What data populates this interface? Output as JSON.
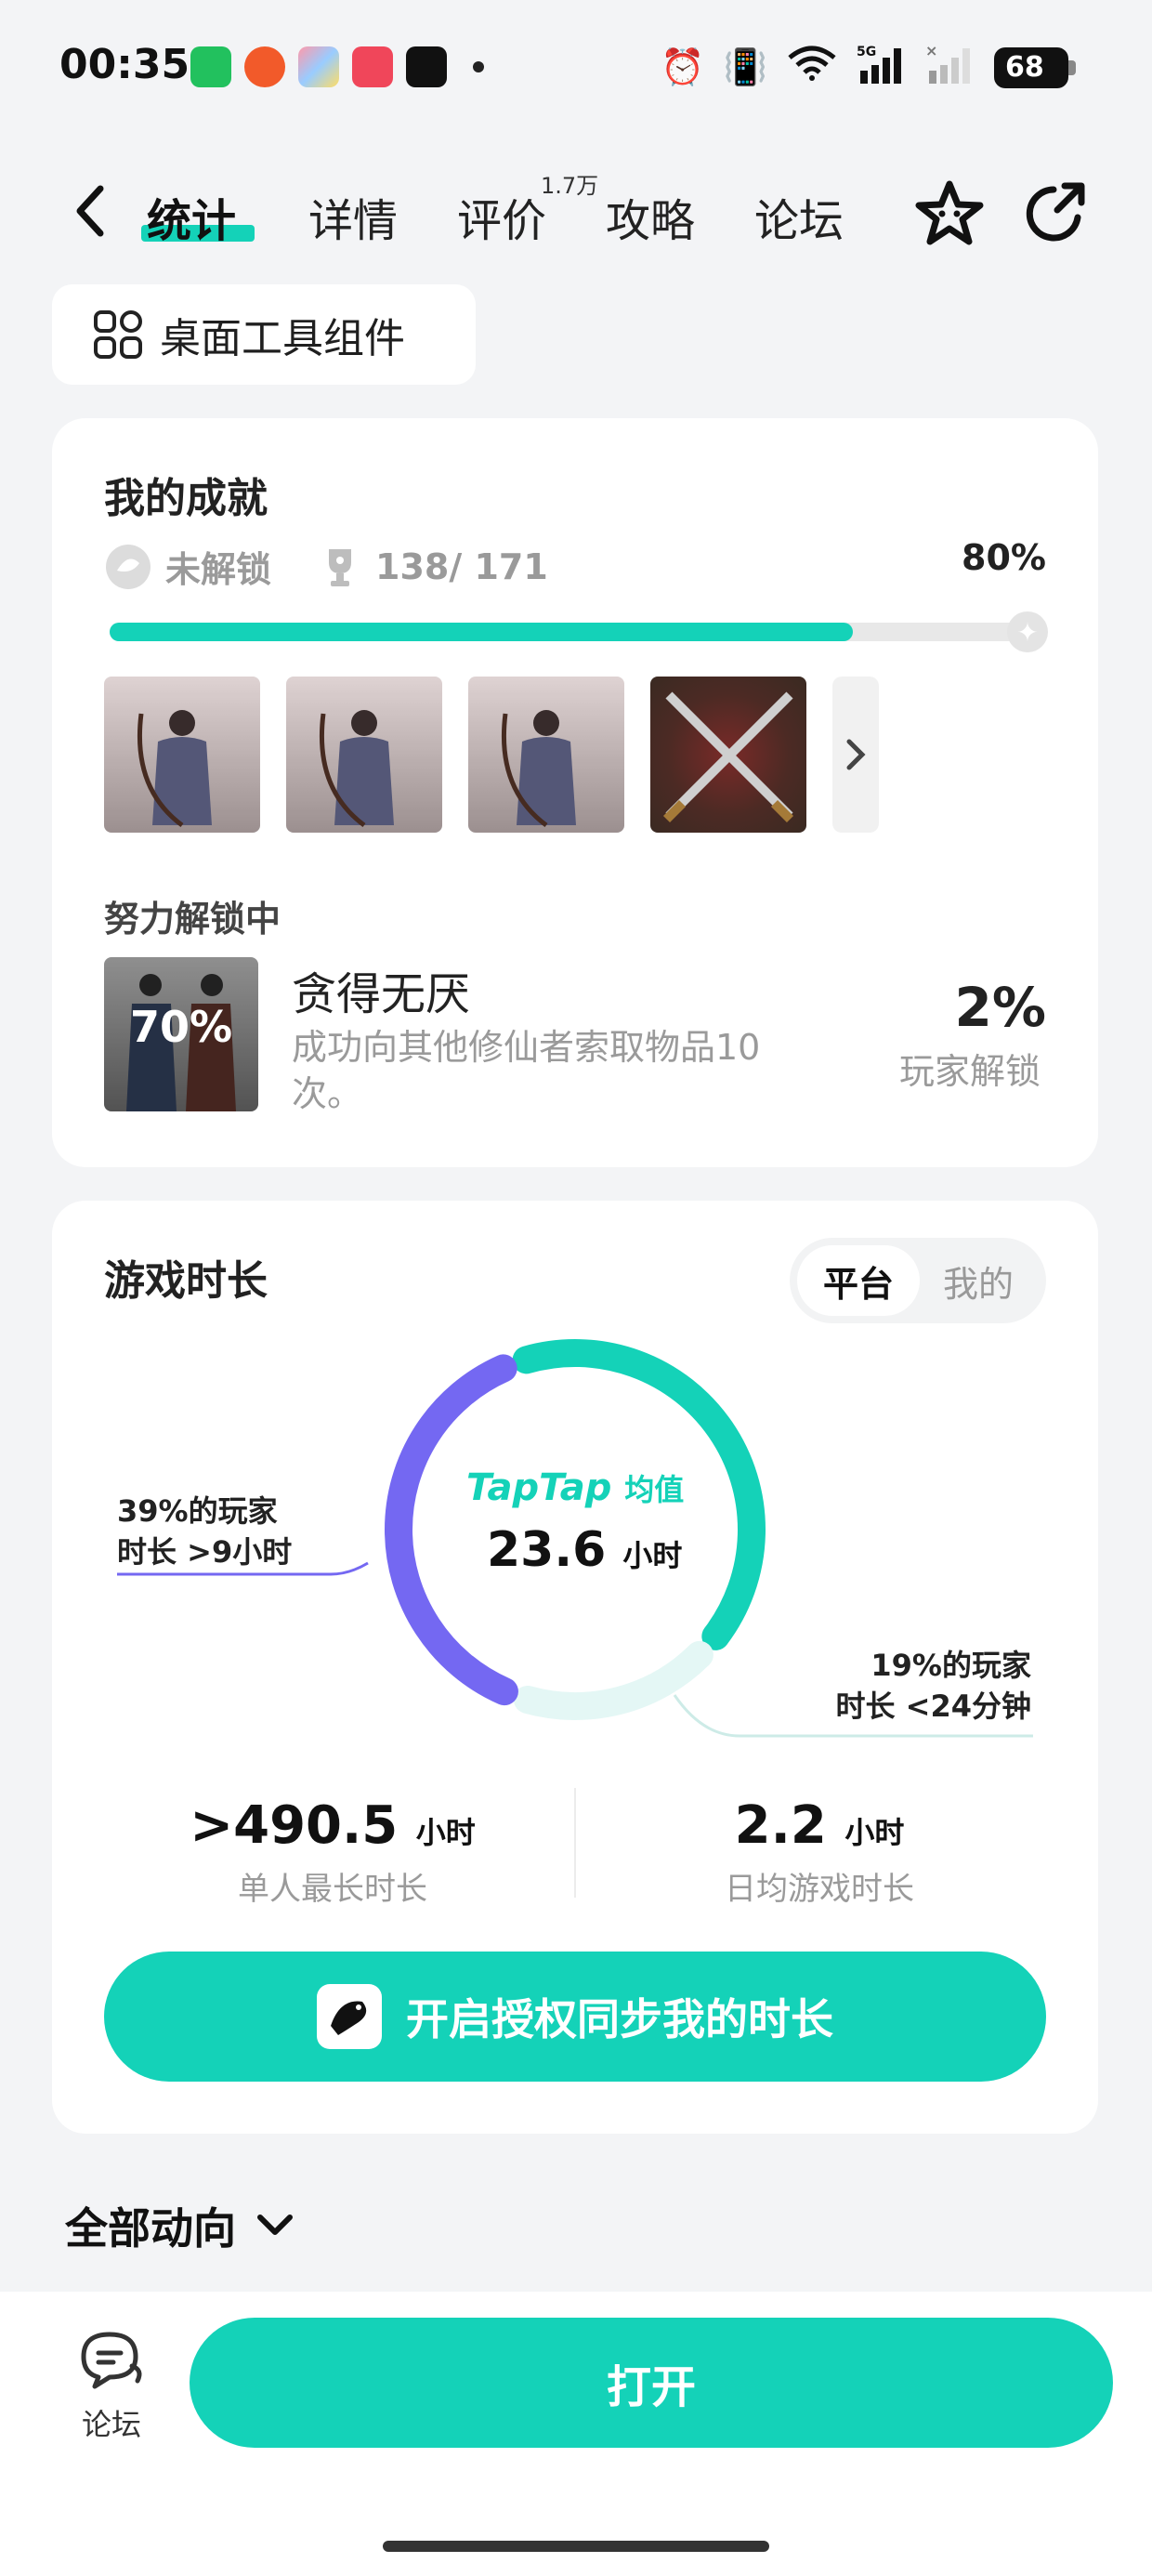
{
  "statusbar": {
    "time": "00:35",
    "battery": "68",
    "app_icons": [
      "wechat-icon",
      "weibo-icon",
      "gallery-icon",
      "video-icon",
      "tiktok-icon"
    ],
    "sys_icons": [
      "alarm-icon",
      "vibrate-icon",
      "wifi-icon",
      "signal-5g-icon",
      "signal-icon"
    ]
  },
  "nav": {
    "tabs": [
      "统计",
      "详情",
      "评价",
      "攻略",
      "论坛"
    ],
    "active_tab": "统计",
    "review_badge": "1.7万"
  },
  "widget_chip": {
    "label": "桌面工具组件"
  },
  "achievements": {
    "title": "我的成就",
    "locked_label": "未解锁",
    "count": "138/ 171",
    "percent_text": "80%",
    "progress": 0.8,
    "in_progress_title": "努力解锁中",
    "current": {
      "progress_text": "70%",
      "name": "贪得无厌",
      "description": "成功向其他修仙者索取物品10次。",
      "rate": "2%",
      "rate_label": "玩家解锁"
    }
  },
  "playtime": {
    "title": "游戏时长",
    "toggle": {
      "on": "平台",
      "off": "我的"
    },
    "brand": "TapTap",
    "brand_suffix": "均值",
    "average_value": "23.6",
    "average_unit": "小时",
    "left_label_line1": "39%的玩家",
    "left_label_line2": "时长 >9小时",
    "right_label_line1": "19%的玩家",
    "right_label_line2": "时长 <24分钟",
    "segments": {
      "above_9h": 0.39,
      "middle": 0.42,
      "below_24min": 0.19
    },
    "max": {
      "value": ">490.5",
      "unit": "小时",
      "label": "单人最长时长"
    },
    "daily": {
      "value": "2.2",
      "unit": "小时",
      "label": "日均游戏时长"
    },
    "sync_button": "开启授权同步我的时长"
  },
  "feed": {
    "label": "全部动向"
  },
  "bottom": {
    "forum_label": "论坛",
    "open_button": "打开"
  },
  "colors": {
    "accent": "#14d2b8",
    "purple": "#7468f2",
    "light_teal": "#e4f7f5"
  }
}
